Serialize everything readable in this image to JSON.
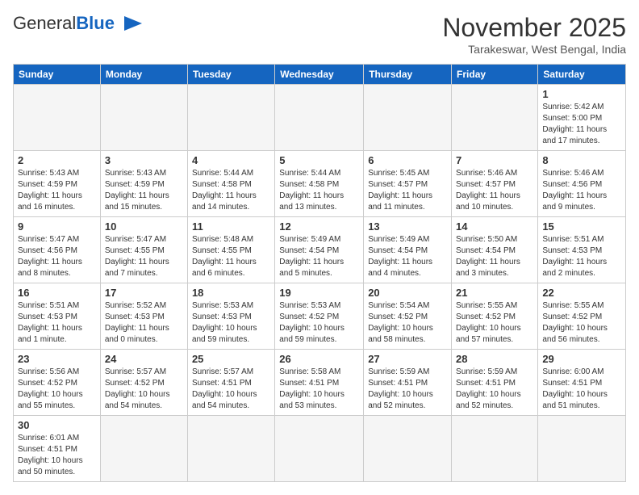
{
  "header": {
    "logo_general": "General",
    "logo_blue": "Blue",
    "month_title": "November 2025",
    "subtitle": "Tarakeswar, West Bengal, India"
  },
  "days_of_week": [
    "Sunday",
    "Monday",
    "Tuesday",
    "Wednesday",
    "Thursday",
    "Friday",
    "Saturday"
  ],
  "weeks": [
    [
      {
        "day": null,
        "info": null
      },
      {
        "day": null,
        "info": null
      },
      {
        "day": null,
        "info": null
      },
      {
        "day": null,
        "info": null
      },
      {
        "day": null,
        "info": null
      },
      {
        "day": null,
        "info": null
      },
      {
        "day": "1",
        "info": "Sunrise: 5:42 AM\nSunset: 5:00 PM\nDaylight: 11 hours and 17 minutes."
      }
    ],
    [
      {
        "day": "2",
        "info": "Sunrise: 5:43 AM\nSunset: 4:59 PM\nDaylight: 11 hours and 16 minutes."
      },
      {
        "day": "3",
        "info": "Sunrise: 5:43 AM\nSunset: 4:59 PM\nDaylight: 11 hours and 15 minutes."
      },
      {
        "day": "4",
        "info": "Sunrise: 5:44 AM\nSunset: 4:58 PM\nDaylight: 11 hours and 14 minutes."
      },
      {
        "day": "5",
        "info": "Sunrise: 5:44 AM\nSunset: 4:58 PM\nDaylight: 11 hours and 13 minutes."
      },
      {
        "day": "6",
        "info": "Sunrise: 5:45 AM\nSunset: 4:57 PM\nDaylight: 11 hours and 11 minutes."
      },
      {
        "day": "7",
        "info": "Sunrise: 5:46 AM\nSunset: 4:57 PM\nDaylight: 11 hours and 10 minutes."
      },
      {
        "day": "8",
        "info": "Sunrise: 5:46 AM\nSunset: 4:56 PM\nDaylight: 11 hours and 9 minutes."
      }
    ],
    [
      {
        "day": "9",
        "info": "Sunrise: 5:47 AM\nSunset: 4:56 PM\nDaylight: 11 hours and 8 minutes."
      },
      {
        "day": "10",
        "info": "Sunrise: 5:47 AM\nSunset: 4:55 PM\nDaylight: 11 hours and 7 minutes."
      },
      {
        "day": "11",
        "info": "Sunrise: 5:48 AM\nSunset: 4:55 PM\nDaylight: 11 hours and 6 minutes."
      },
      {
        "day": "12",
        "info": "Sunrise: 5:49 AM\nSunset: 4:54 PM\nDaylight: 11 hours and 5 minutes."
      },
      {
        "day": "13",
        "info": "Sunrise: 5:49 AM\nSunset: 4:54 PM\nDaylight: 11 hours and 4 minutes."
      },
      {
        "day": "14",
        "info": "Sunrise: 5:50 AM\nSunset: 4:54 PM\nDaylight: 11 hours and 3 minutes."
      },
      {
        "day": "15",
        "info": "Sunrise: 5:51 AM\nSunset: 4:53 PM\nDaylight: 11 hours and 2 minutes."
      }
    ],
    [
      {
        "day": "16",
        "info": "Sunrise: 5:51 AM\nSunset: 4:53 PM\nDaylight: 11 hours and 1 minute."
      },
      {
        "day": "17",
        "info": "Sunrise: 5:52 AM\nSunset: 4:53 PM\nDaylight: 11 hours and 0 minutes."
      },
      {
        "day": "18",
        "info": "Sunrise: 5:53 AM\nSunset: 4:53 PM\nDaylight: 10 hours and 59 minutes."
      },
      {
        "day": "19",
        "info": "Sunrise: 5:53 AM\nSunset: 4:52 PM\nDaylight: 10 hours and 59 minutes."
      },
      {
        "day": "20",
        "info": "Sunrise: 5:54 AM\nSunset: 4:52 PM\nDaylight: 10 hours and 58 minutes."
      },
      {
        "day": "21",
        "info": "Sunrise: 5:55 AM\nSunset: 4:52 PM\nDaylight: 10 hours and 57 minutes."
      },
      {
        "day": "22",
        "info": "Sunrise: 5:55 AM\nSunset: 4:52 PM\nDaylight: 10 hours and 56 minutes."
      }
    ],
    [
      {
        "day": "23",
        "info": "Sunrise: 5:56 AM\nSunset: 4:52 PM\nDaylight: 10 hours and 55 minutes."
      },
      {
        "day": "24",
        "info": "Sunrise: 5:57 AM\nSunset: 4:52 PM\nDaylight: 10 hours and 54 minutes."
      },
      {
        "day": "25",
        "info": "Sunrise: 5:57 AM\nSunset: 4:51 PM\nDaylight: 10 hours and 54 minutes."
      },
      {
        "day": "26",
        "info": "Sunrise: 5:58 AM\nSunset: 4:51 PM\nDaylight: 10 hours and 53 minutes."
      },
      {
        "day": "27",
        "info": "Sunrise: 5:59 AM\nSunset: 4:51 PM\nDaylight: 10 hours and 52 minutes."
      },
      {
        "day": "28",
        "info": "Sunrise: 5:59 AM\nSunset: 4:51 PM\nDaylight: 10 hours and 52 minutes."
      },
      {
        "day": "29",
        "info": "Sunrise: 6:00 AM\nSunset: 4:51 PM\nDaylight: 10 hours and 51 minutes."
      }
    ],
    [
      {
        "day": "30",
        "info": "Sunrise: 6:01 AM\nSunset: 4:51 PM\nDaylight: 10 hours and 50 minutes."
      },
      {
        "day": null,
        "info": null
      },
      {
        "day": null,
        "info": null
      },
      {
        "day": null,
        "info": null
      },
      {
        "day": null,
        "info": null
      },
      {
        "day": null,
        "info": null
      },
      {
        "day": null,
        "info": null
      }
    ]
  ]
}
